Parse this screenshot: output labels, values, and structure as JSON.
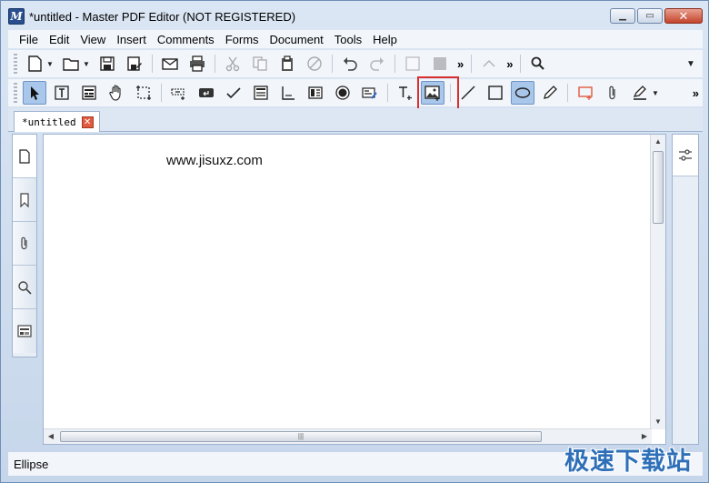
{
  "window": {
    "title": "*untitled - Master PDF Editor (NOT REGISTERED)",
    "app_icon_letter": "M"
  },
  "menubar": {
    "items": [
      "File",
      "Edit",
      "View",
      "Insert",
      "Comments",
      "Forms",
      "Document",
      "Tools",
      "Help"
    ]
  },
  "toolbar1": {
    "more_label": "»",
    "more2_label": "»"
  },
  "toolbar2": {
    "more_label": "»",
    "selected_tool": "add-image",
    "pressed_tool": "ellipse"
  },
  "tabs": [
    {
      "label": "*untitled"
    }
  ],
  "document": {
    "page_text": "www.jisuxz.com"
  },
  "status": {
    "text": "Ellipse"
  },
  "watermark": {
    "text": "极速下载站"
  },
  "colors": {
    "highlight_box": "#d9302f",
    "pressed_bg": "#a9c7ea",
    "watermark": "#2e6fb8"
  }
}
